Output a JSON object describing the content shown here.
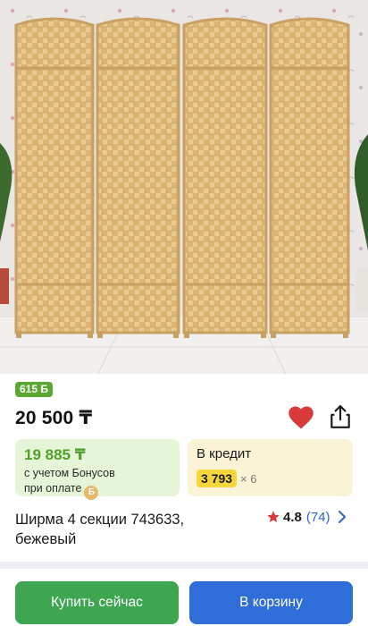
{
  "product": {
    "bonus_badge": "615 Б",
    "price": "20 500 ₸",
    "bonus_price": "19 885 ₸",
    "bonus_note_line1": "с учетом Бонусов",
    "bonus_note_line2": "при оплате",
    "bonus_coin_symbol": "Б",
    "credit_title": "В кредит",
    "credit_monthly": "3 793",
    "credit_months": "× 6",
    "title": "Ширма 4 секции 743633, бежевый",
    "rating": "4.8",
    "reviews": "(74)"
  },
  "actions": {
    "buy_now": "Купить сейчас",
    "add_to_cart": "В корзину"
  },
  "icons": {
    "favorite": "heart-icon",
    "share": "share-icon",
    "rating": "star-icon",
    "more": "chevron-right-icon"
  },
  "colors": {
    "bonus_green": "#5aa82f",
    "favorite_red": "#d83a3a",
    "credit_yellow": "#f5d63d",
    "buy_green": "#3ea551",
    "cart_blue": "#2f6dd8",
    "link_blue": "#2e63c8"
  }
}
